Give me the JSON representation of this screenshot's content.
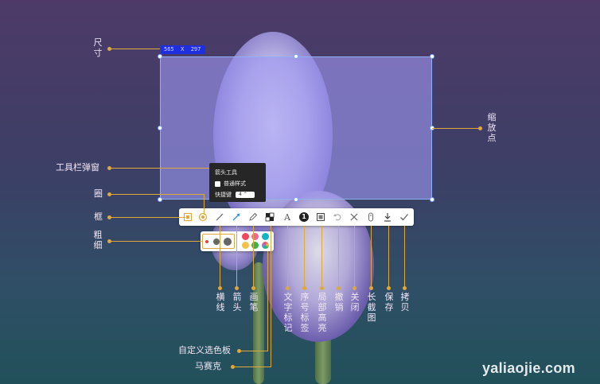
{
  "selection": {
    "size_label": "565  X  297"
  },
  "arrow_popup": {
    "title": "箭头工具",
    "normal_style": "普通样式",
    "shortcut_label": "快捷键",
    "shortcut_value": "4"
  },
  "toolbar": {
    "tools": [
      {
        "name": "rectangle",
        "icon": "square-icon"
      },
      {
        "name": "circle",
        "icon": "circle-icon"
      },
      {
        "name": "line",
        "icon": "line-icon"
      },
      {
        "name": "arrow",
        "icon": "arrow-icon"
      },
      {
        "name": "pen",
        "icon": "pencil-icon"
      },
      {
        "name": "mosaic",
        "icon": "mosaic-icon"
      },
      {
        "name": "text",
        "icon": "text-icon",
        "glyph": "A"
      },
      {
        "name": "number",
        "icon": "number-badge-icon",
        "glyph": "1"
      },
      {
        "name": "highlight",
        "icon": "highlight-icon"
      },
      {
        "name": "undo",
        "icon": "undo-icon"
      },
      {
        "name": "close",
        "icon": "close-icon"
      },
      {
        "name": "long-shot",
        "icon": "mouse-icon"
      },
      {
        "name": "save",
        "icon": "download-icon"
      },
      {
        "name": "copy",
        "icon": "check-icon"
      }
    ]
  },
  "palette": {
    "colors": [
      "#f0495c",
      "#ef6a8f",
      "#12b3c4",
      "#f2c14b",
      "#3bb54a",
      "#b56bd6"
    ]
  },
  "labels": {
    "size": "尺寸",
    "zoom_point": "缩放点",
    "toolbar_popup": "工具栏弹窗",
    "circle": "圈",
    "frame": "框",
    "thickness": "粗细",
    "hline": "横线",
    "arrow": "箭头",
    "pen": "画笔",
    "text_mark": "文字标记",
    "number_tag": "序号标签",
    "local_highlight": "局部高亮",
    "undo": "撤销",
    "close": "关闭",
    "long_shot": "长截图",
    "save": "保存",
    "copy": "拷贝",
    "custom_palette": "自定义选色板",
    "mosaic": "马赛克"
  },
  "watermark": "yaliaojie.com",
  "accent_color": "#e0a83a"
}
